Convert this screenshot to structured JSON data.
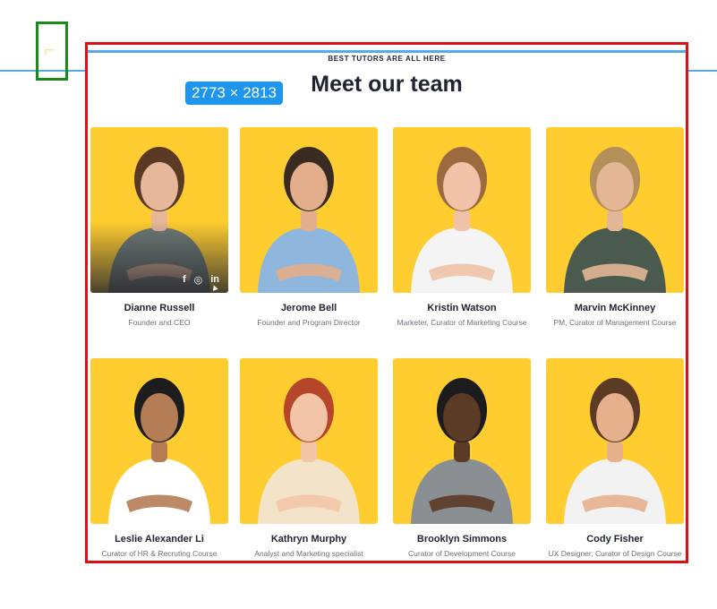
{
  "overlay": {
    "dimensions_badge": "2773 × 2813"
  },
  "section": {
    "eyebrow": "BEST TUTORS ARE ALL HERE",
    "title": "Meet our team"
  },
  "colors": {
    "card_bg": "#ffcd2f",
    "badge": "#1e96f0",
    "selection_frame": "#e20e17",
    "logo_frame": "#1a8a1a"
  },
  "team": [
    {
      "name": "Dianne Russell",
      "role": "Founder and CEO",
      "shirt": "#6e7a77",
      "skin": "#e7b79a",
      "hair": "#5a3a24",
      "hover": true
    },
    {
      "name": "Jerome Bell",
      "role": "Founder and Program Director",
      "shirt": "#8fb6dd",
      "skin": "#e2ae8c",
      "hair": "#3a2b22"
    },
    {
      "name": "Kristin Watson",
      "role": "Marketer, Curator of Marketing Course",
      "shirt": "#f4f4f4",
      "skin": "#f0c3a8",
      "hair": "#9b6b3f"
    },
    {
      "name": "Marvin McKinney",
      "role": "PM, Curator of Management Course",
      "shirt": "#4b5a4f",
      "skin": "#e3b696",
      "hair": "#b58f5a"
    },
    {
      "name": "Leslie Alexander Li",
      "role": "Curator of HR & Recruting Course",
      "shirt": "#ffffff",
      "skin": "#b57d55",
      "hair": "#1d1d1d"
    },
    {
      "name": "Kathryn Murphy",
      "role": "Analyst and Marketing specialist",
      "shirt": "#f3e3c9",
      "skin": "#f2c5a6",
      "hair": "#b5462a"
    },
    {
      "name": "Brooklyn Simmons",
      "role": "Curator of Development Course",
      "shirt": "#8a8f94",
      "skin": "#5b3a26",
      "hair": "#1c1c1c"
    },
    {
      "name": "Cody Fisher",
      "role": "UX Designer, Curator of Design Course",
      "shirt": "#f2f2f2",
      "skin": "#e6b08d",
      "hair": "#5b3b24"
    }
  ],
  "social": [
    "facebook-icon",
    "instagram-icon",
    "linkedin-icon"
  ],
  "social_glyphs": {
    "facebook": "f",
    "instagram": "◎",
    "linkedin": "in"
  }
}
